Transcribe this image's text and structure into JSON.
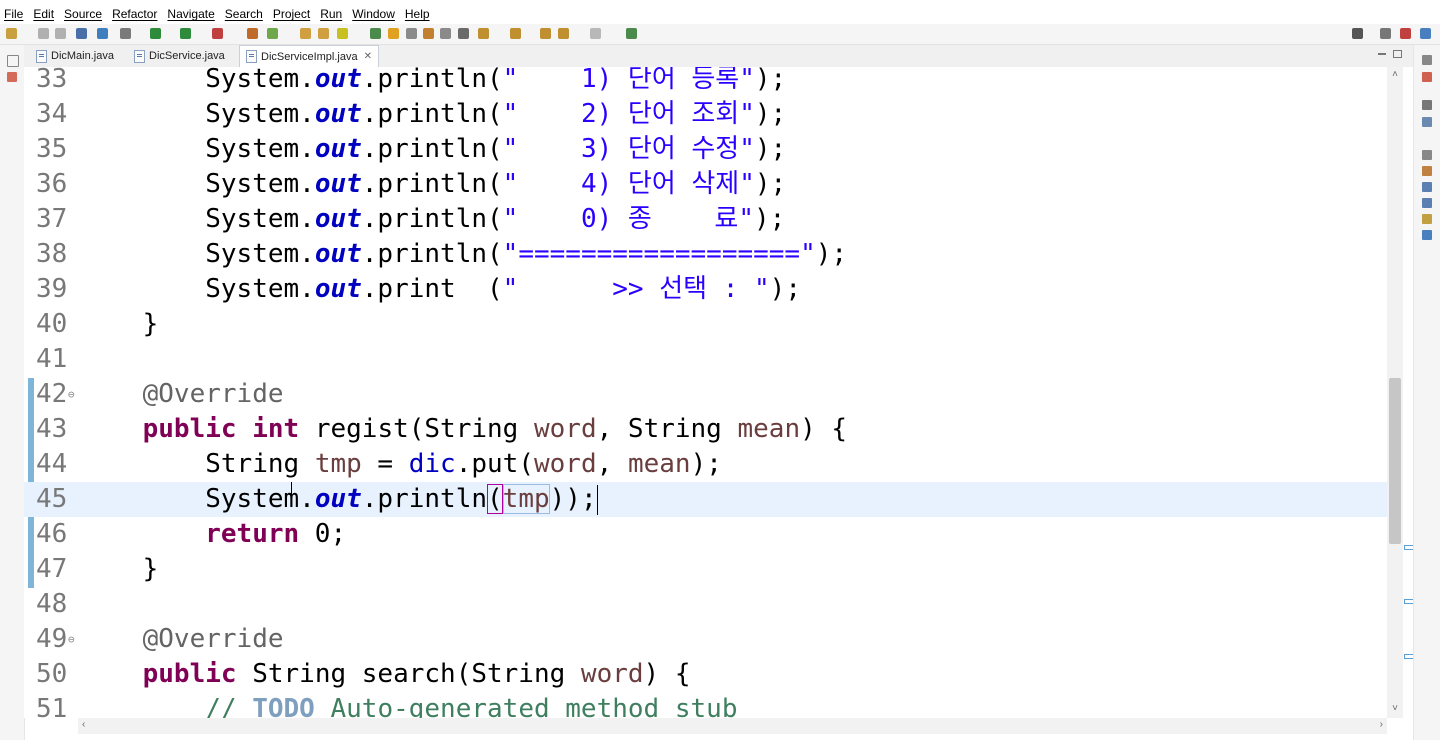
{
  "menu": [
    "File",
    "Edit",
    "Source",
    "Refactor",
    "Navigate",
    "Search",
    "Project",
    "Run",
    "Window",
    "Help"
  ],
  "tabs": [
    {
      "label": "DicMain.java",
      "active": false
    },
    {
      "label": "DicService.java",
      "active": false
    },
    {
      "label": "DicServiceImpl.java",
      "active": true
    }
  ],
  "tab_close_glyph": "✕",
  "editor": {
    "current_line": "45",
    "lines": [
      {
        "num": "33",
        "indent": "        ",
        "parts": [
          {
            "t": "System.",
            "c": ""
          },
          {
            "t": "out",
            "c": "fld"
          },
          {
            "t": ".println(",
            "c": ""
          },
          {
            "t": "\"    1) 단어 등록\"",
            "c": "str"
          },
          {
            "t": ");",
            "c": ""
          }
        ]
      },
      {
        "num": "34",
        "indent": "        ",
        "parts": [
          {
            "t": "System.",
            "c": ""
          },
          {
            "t": "out",
            "c": "fld"
          },
          {
            "t": ".println(",
            "c": ""
          },
          {
            "t": "\"    2) 단어 조회\"",
            "c": "str"
          },
          {
            "t": ");",
            "c": ""
          }
        ]
      },
      {
        "num": "35",
        "indent": "        ",
        "parts": [
          {
            "t": "System.",
            "c": ""
          },
          {
            "t": "out",
            "c": "fld"
          },
          {
            "t": ".println(",
            "c": ""
          },
          {
            "t": "\"    3) 단어 수정\"",
            "c": "str"
          },
          {
            "t": ");",
            "c": ""
          }
        ]
      },
      {
        "num": "36",
        "indent": "        ",
        "parts": [
          {
            "t": "System.",
            "c": ""
          },
          {
            "t": "out",
            "c": "fld"
          },
          {
            "t": ".println(",
            "c": ""
          },
          {
            "t": "\"    4) 단어 삭제\"",
            "c": "str"
          },
          {
            "t": ");",
            "c": ""
          }
        ]
      },
      {
        "num": "37",
        "indent": "        ",
        "parts": [
          {
            "t": "System.",
            "c": ""
          },
          {
            "t": "out",
            "c": "fld"
          },
          {
            "t": ".println(",
            "c": ""
          },
          {
            "t": "\"    0) 종    료\"",
            "c": "str"
          },
          {
            "t": ");",
            "c": ""
          }
        ]
      },
      {
        "num": "38",
        "indent": "        ",
        "parts": [
          {
            "t": "System.",
            "c": ""
          },
          {
            "t": "out",
            "c": "fld"
          },
          {
            "t": ".println(",
            "c": ""
          },
          {
            "t": "\"==================\"",
            "c": "str"
          },
          {
            "t": ");",
            "c": ""
          }
        ]
      },
      {
        "num": "39",
        "indent": "        ",
        "parts": [
          {
            "t": "System.",
            "c": ""
          },
          {
            "t": "out",
            "c": "fld"
          },
          {
            "t": ".print  (",
            "c": ""
          },
          {
            "t": "\"      >> 선택 : \"",
            "c": "str"
          },
          {
            "t": ");",
            "c": ""
          }
        ]
      },
      {
        "num": "40",
        "indent": "    ",
        "parts": [
          {
            "t": "}",
            "c": ""
          }
        ]
      },
      {
        "num": "41",
        "indent": "",
        "parts": []
      },
      {
        "num": "42",
        "indent": "    ",
        "fold": "⊖",
        "parts": [
          {
            "t": "@Override",
            "c": "ann"
          }
        ]
      },
      {
        "num": "43",
        "indent": "    ",
        "parts": [
          {
            "t": "public",
            "c": "kw"
          },
          {
            "t": " ",
            "c": ""
          },
          {
            "t": "int",
            "c": "kw"
          },
          {
            "t": " regist(String ",
            "c": ""
          },
          {
            "t": "word",
            "c": "var"
          },
          {
            "t": ", String ",
            "c": ""
          },
          {
            "t": "mean",
            "c": "var"
          },
          {
            "t": ") {",
            "c": ""
          }
        ]
      },
      {
        "num": "44",
        "indent": "        ",
        "parts": [
          {
            "t": "String ",
            "c": ""
          },
          {
            "t": "tmp",
            "c": "var"
          },
          {
            "t": " = ",
            "c": ""
          },
          {
            "t": "dic",
            "c": "mem"
          },
          {
            "t": ".put(",
            "c": ""
          },
          {
            "t": "word",
            "c": "var"
          },
          {
            "t": ", ",
            "c": ""
          },
          {
            "t": "mean",
            "c": "var"
          },
          {
            "t": ");",
            "c": ""
          }
        ]
      },
      {
        "num": "45",
        "indent": "        ",
        "parts": [
          {
            "t": "System.",
            "c": ""
          },
          {
            "t": "out",
            "c": "fld"
          },
          {
            "t": ".println",
            "c": ""
          },
          {
            "t": "(",
            "c": "bracket"
          },
          {
            "t": "tmp",
            "c": "var hl-param"
          },
          {
            "t": ")",
            "c": ""
          },
          {
            "t": ");",
            "c": ""
          }
        ],
        "caret": true
      },
      {
        "num": "46",
        "indent": "        ",
        "parts": [
          {
            "t": "return",
            "c": "kw"
          },
          {
            "t": " 0;",
            "c": ""
          }
        ]
      },
      {
        "num": "47",
        "indent": "    ",
        "parts": [
          {
            "t": "}",
            "c": ""
          }
        ]
      },
      {
        "num": "48",
        "indent": "",
        "parts": []
      },
      {
        "num": "49",
        "indent": "    ",
        "fold": "⊖",
        "parts": [
          {
            "t": "@Override",
            "c": "ann"
          }
        ]
      },
      {
        "num": "50",
        "indent": "    ",
        "marker": "▵",
        "parts": [
          {
            "t": "public",
            "c": "kw"
          },
          {
            "t": " String search(String ",
            "c": ""
          },
          {
            "t": "word",
            "c": "var"
          },
          {
            "t": ") {",
            "c": ""
          }
        ]
      },
      {
        "num": "51",
        "indent": "        ",
        "marker": "☒",
        "parts": [
          {
            "t": "// ",
            "c": "cmt"
          },
          {
            "t": "TODO",
            "c": "todo"
          },
          {
            "t": " Auto-generated method stub",
            "c": "cmt"
          }
        ]
      }
    ]
  },
  "colors": {
    "keyword": "#7f0055",
    "field": "#0000c0",
    "string": "#2a00ff",
    "annotation": "#646464",
    "variable": "#6a3e3e",
    "comment": "#3f7f5f",
    "current_line": "#e8f2fe",
    "change_bar": "#7fb5d8"
  },
  "scroll": {
    "up_glyph": "˄",
    "down_glyph": "˅",
    "left_glyph": "‹",
    "right_glyph": "›"
  }
}
